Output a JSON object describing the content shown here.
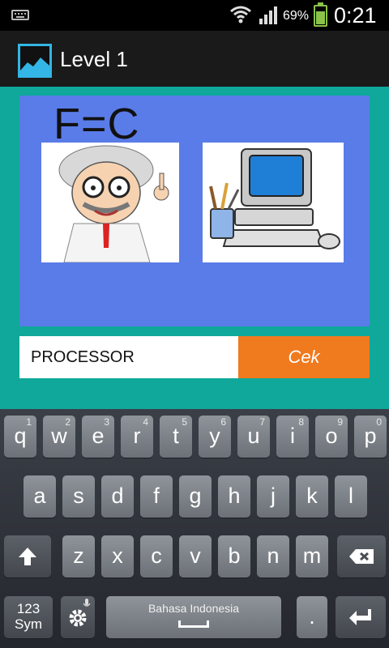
{
  "status_bar": {
    "keyboard_icon": "keyboard-icon",
    "wifi_icon": "wifi-icon",
    "signal_icon": "signal-icon",
    "battery_percent": "69%",
    "battery_icon": "battery-icon",
    "battery_level": 0.69,
    "time": "0:21"
  },
  "action_bar": {
    "app_icon": "image-icon",
    "title": "Level 1"
  },
  "puzzle": {
    "formula": "F=C",
    "images": [
      "scientist-clipart",
      "computer-clipart"
    ]
  },
  "answer": {
    "value": "PROCESSOR",
    "button_label": "Cek"
  },
  "keyboard": {
    "row1": [
      {
        "key": "q",
        "hint": "1"
      },
      {
        "key": "w",
        "hint": "2"
      },
      {
        "key": "e",
        "hint": "3"
      },
      {
        "key": "r",
        "hint": "4"
      },
      {
        "key": "t",
        "hint": "5"
      },
      {
        "key": "y",
        "hint": "6"
      },
      {
        "key": "u",
        "hint": "7"
      },
      {
        "key": "i",
        "hint": "8"
      },
      {
        "key": "o",
        "hint": "9"
      },
      {
        "key": "p",
        "hint": "0"
      }
    ],
    "row2": [
      "a",
      "s",
      "d",
      "f",
      "g",
      "h",
      "j",
      "k",
      "l"
    ],
    "row3": [
      "z",
      "x",
      "c",
      "v",
      "b",
      "n",
      "m"
    ],
    "sym_line1": "123",
    "sym_line2": "Sym",
    "space_label": "Bahasa Indonesia",
    "period": ".",
    "shift_icon": "shift-arrow-icon",
    "backspace_icon": "backspace-icon",
    "settings_icon": "gear-icon",
    "enter_icon": "enter-icon"
  },
  "colors": {
    "background": "#0fa89a",
    "puzzle_panel": "#5a7ce8",
    "check_button": "#f07a1e",
    "battery": "#8bc34a",
    "app_icon_border": "#33b5e5"
  }
}
